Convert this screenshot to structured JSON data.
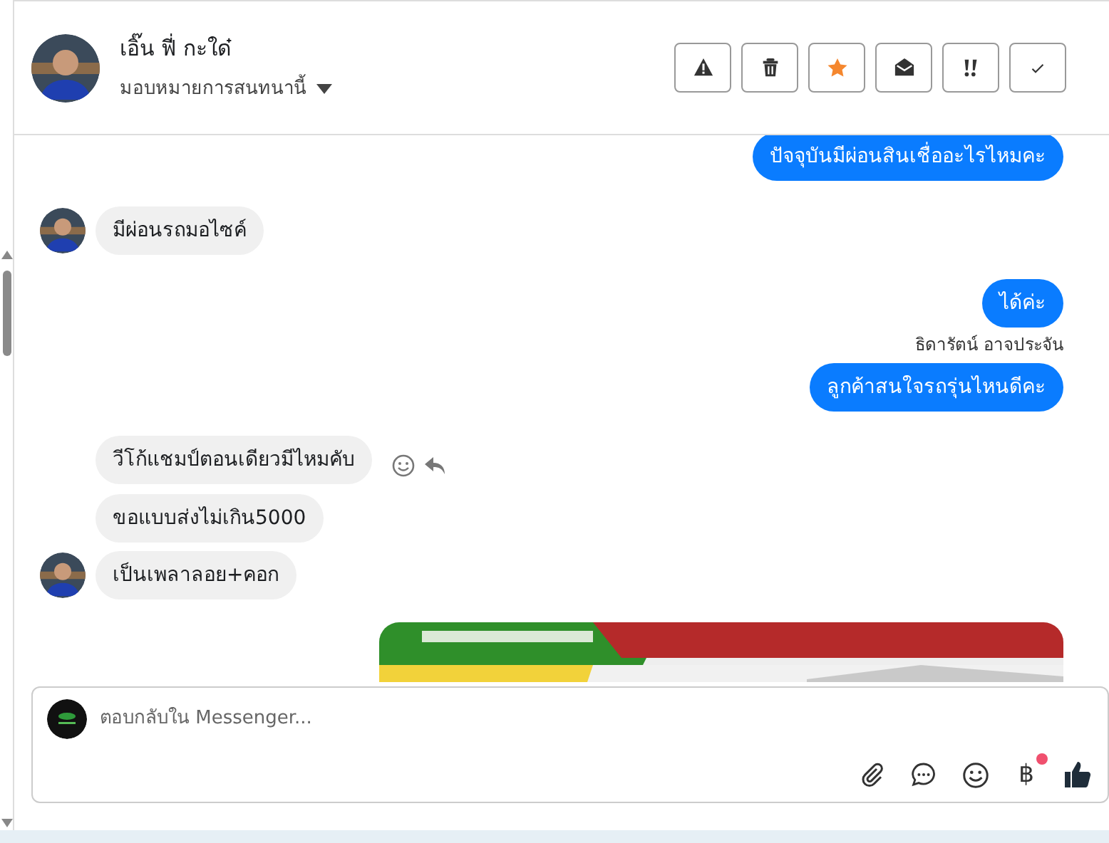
{
  "contact": {
    "name": "เอิ๊น ฟี่ กะใด๋",
    "assign_label": "มอบหมายการสนทนานี้"
  },
  "actions": [
    {
      "kind": "spam",
      "active": false
    },
    {
      "kind": "trash",
      "active": false
    },
    {
      "kind": "star",
      "active": true
    },
    {
      "kind": "unread",
      "active": false
    },
    {
      "kind": "important",
      "active": false
    },
    {
      "kind": "done",
      "active": false
    }
  ],
  "messages": [
    {
      "kind": "out",
      "text": "ปัจจุบันมีผ่อนสินเชื่ออะไรไหมคะ"
    },
    {
      "kind": "in",
      "text": "มีผ่อนรถมอไซค์",
      "avatar": true
    },
    {
      "kind": "out",
      "text": "ได้ค่ะ",
      "sender": "ธิดารัตน์ อาจประจัน"
    },
    {
      "kind": "out",
      "text": "ลูกค้าสนใจรถรุ่นไหนดีคะ"
    },
    {
      "kind": "in",
      "text": "วีโก้แชมป์ตอนเดียวมีไหมคับ",
      "hover_actions": true
    },
    {
      "kind": "in",
      "text": "ขอแบบส่งไม่เกิน5000"
    },
    {
      "kind": "in",
      "text": "เป็นเพลาลอย+คอก",
      "avatar": true
    },
    {
      "kind": "picture"
    }
  ],
  "composer": {
    "placeholder": "ตอบกลับใน Messenger...",
    "currency_symbol": "฿",
    "currency_notification": true
  }
}
